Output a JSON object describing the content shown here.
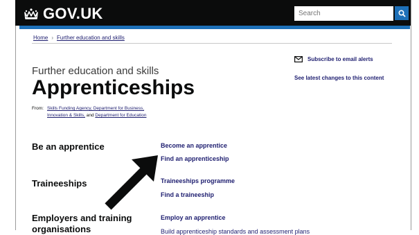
{
  "header": {
    "logo_text": "GOV.UK",
    "search_placeholder": "Search",
    "search_icon": "magnifier-icon",
    "colors": {
      "background": "#0b0c0c",
      "accent": "#1d70b8"
    }
  },
  "breadcrumb": [
    "Home",
    "Further education and skills"
  ],
  "page": {
    "section": "Further education and skills",
    "title": "Apprenticeships",
    "from_label": "From:",
    "from_line1": "Skills Funding Agency, Department for Business,",
    "from_line2_a": "Innovation & Skills,",
    "from_line2_and": " and ",
    "from_line2_b": "Department for Education"
  },
  "aside": {
    "subscribe": "Subscribe to email alerts",
    "latest": "See latest changes to this content"
  },
  "groups": [
    {
      "heading": "Be an apprentice",
      "links": [
        "Become an apprentice",
        "Find an apprenticeship"
      ]
    },
    {
      "heading": "Traineeships",
      "links": [
        "Traineeships programme",
        "Find a traineeship"
      ]
    },
    {
      "heading": "Employers and training organisations",
      "links": [
        "Employ an apprentice",
        "Build apprenticeship standards and assessment plans"
      ]
    }
  ]
}
